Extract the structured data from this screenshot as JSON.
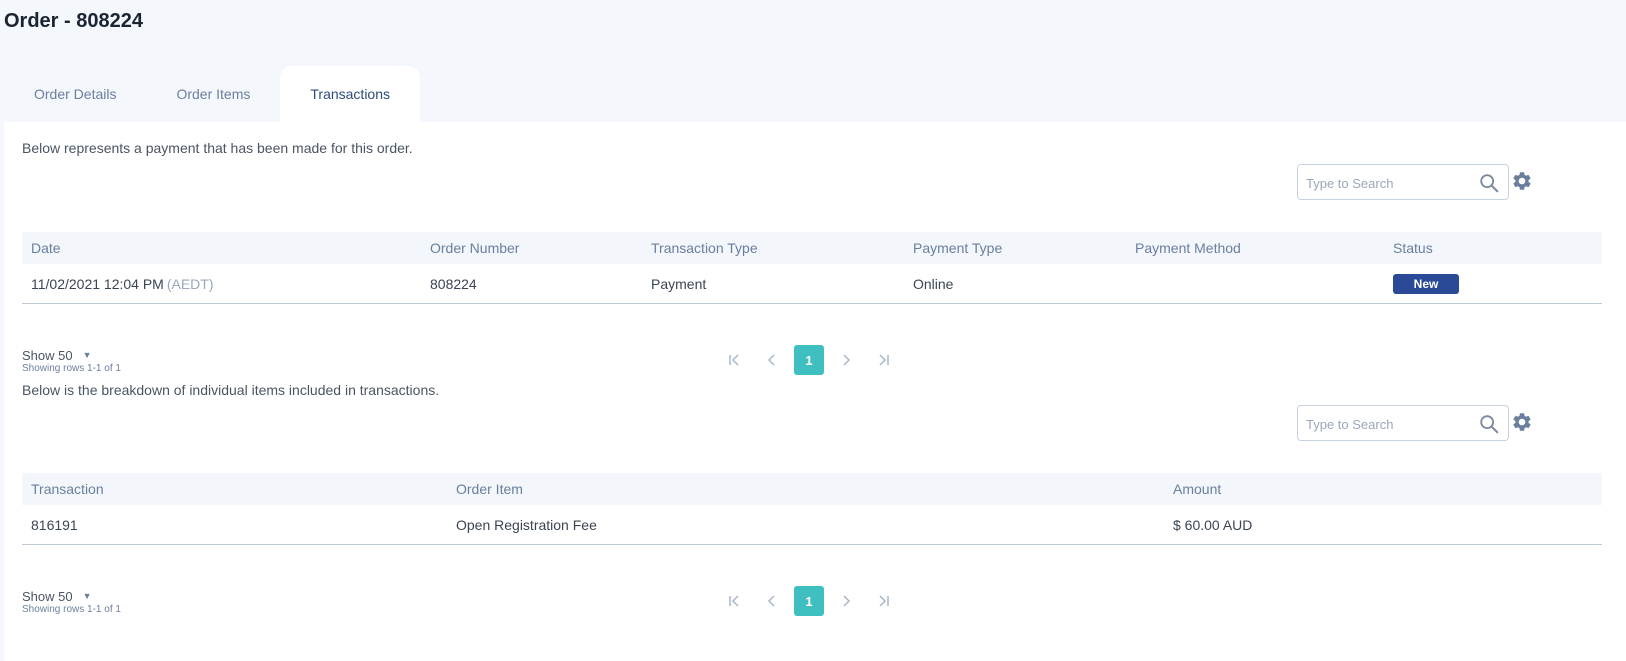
{
  "page": {
    "title": "Order - 808224"
  },
  "tabs": [
    {
      "label": "Order Details",
      "active": false
    },
    {
      "label": "Order Items",
      "active": false
    },
    {
      "label": "Transactions",
      "active": true
    }
  ],
  "payments": {
    "intro": "Below represents a payment that has been made for this order.",
    "search_placeholder": "Type to Search",
    "columns": [
      "Date",
      "Order Number",
      "Transaction Type",
      "Payment Type",
      "Payment Method",
      "Status"
    ],
    "rows": [
      {
        "date": "11/02/2021 12:04 PM",
        "timezone": "(AEDT)",
        "order_number": "808224",
        "transaction_type": "Payment",
        "payment_type": "Online",
        "payment_method": "",
        "status": "New"
      }
    ],
    "show_label": "Show 50",
    "rows_info": "Showing rows 1-1 of 1",
    "current_page": "1"
  },
  "items": {
    "intro": "Below is the breakdown of individual items included in transactions.",
    "search_placeholder": "Type to Search",
    "columns": [
      "Transaction",
      "Order Item",
      "Amount"
    ],
    "rows": [
      {
        "transaction": "816191",
        "order_item": "Open Registration Fee",
        "amount": "$ 60.00 AUD"
      }
    ],
    "show_label": "Show 50",
    "rows_info": "Showing rows 1-1 of 1",
    "current_page": "1"
  },
  "colors": {
    "accent": "#3fbfbf",
    "badge": "#2a4a97",
    "background": "#f4f7fb"
  }
}
